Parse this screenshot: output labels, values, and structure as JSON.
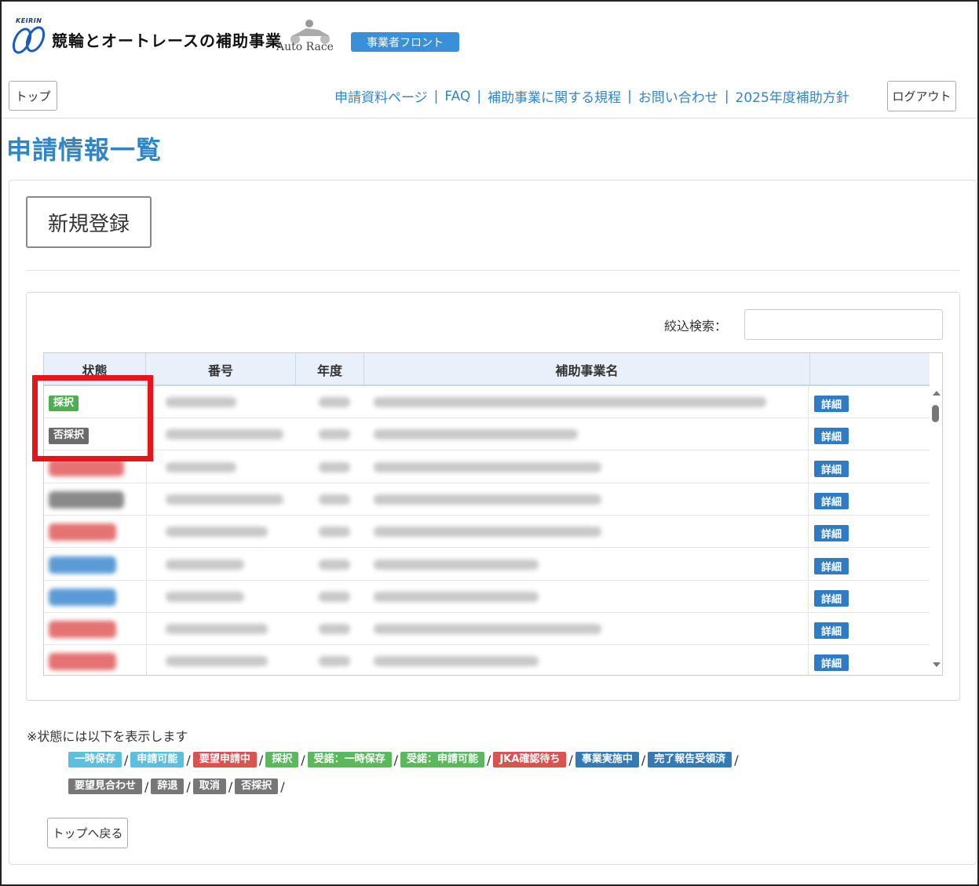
{
  "header": {
    "logo_small": "KEIRIN",
    "logo_title": "競輪とオートレースの補助事業",
    "logo_sub": "Auto Race",
    "front_badge": "事業者フロント",
    "top_button": "トップ",
    "logout_button": "ログアウト",
    "nav": [
      "申請資料ページ",
      "FAQ",
      "補助事業に関する規程",
      "お問い合わせ",
      "2025年度補助方針"
    ],
    "nav_separator": "|"
  },
  "page_title": "申請情報一覧",
  "new_button": "新規登録",
  "search": {
    "label": "絞込検索：",
    "value": "",
    "placeholder": ""
  },
  "table": {
    "columns": [
      "状態",
      "番号",
      "年度",
      "補助事業名",
      ""
    ],
    "detail_label": "詳細",
    "rows": [
      {
        "status": "採択",
        "status_color": "#4caf50"
      },
      {
        "status": "否採択",
        "status_color": "#6b6b6b"
      },
      {
        "status": "",
        "status_color": "#e57373"
      },
      {
        "status": "",
        "status_color": "#8a8a8a"
      },
      {
        "status": "",
        "status_color": "#e57373"
      },
      {
        "status": "",
        "status_color": "#5b9bd5"
      },
      {
        "status": "",
        "status_color": "#5b9bd5"
      },
      {
        "status": "",
        "status_color": "#e57373"
      },
      {
        "status": "",
        "status_color": "#e57373"
      }
    ]
  },
  "legend": {
    "note": "※状態には以下を表示します",
    "separator": "/",
    "row1": [
      {
        "label": "一時保存",
        "color": "#5bc0de"
      },
      {
        "label": "申請可能",
        "color": "#5bc0de"
      },
      {
        "label": "要望申請中",
        "color": "#d9534f"
      },
      {
        "label": "採択",
        "color": "#5cb85c"
      },
      {
        "label": "受諾：一時保存",
        "color": "#5cb85c"
      },
      {
        "label": "受諾：申請可能",
        "color": "#5cb85c"
      },
      {
        "label": "JKA確認待ち",
        "color": "#d9534f"
      },
      {
        "label": "事業実施中",
        "color": "#337ab7"
      },
      {
        "label": "完了報告受領済",
        "color": "#337ab7"
      }
    ],
    "row2": [
      {
        "label": "要望見合わせ",
        "color": "#777777"
      },
      {
        "label": "辞退",
        "color": "#777777"
      },
      {
        "label": "取消",
        "color": "#777777"
      },
      {
        "label": "否採択",
        "color": "#777777"
      }
    ]
  },
  "back_button": "トップへ戻る",
  "colors": {
    "accent": "#2f86c7",
    "highlight": "#e8141d",
    "detail": "#2f7bc4"
  }
}
